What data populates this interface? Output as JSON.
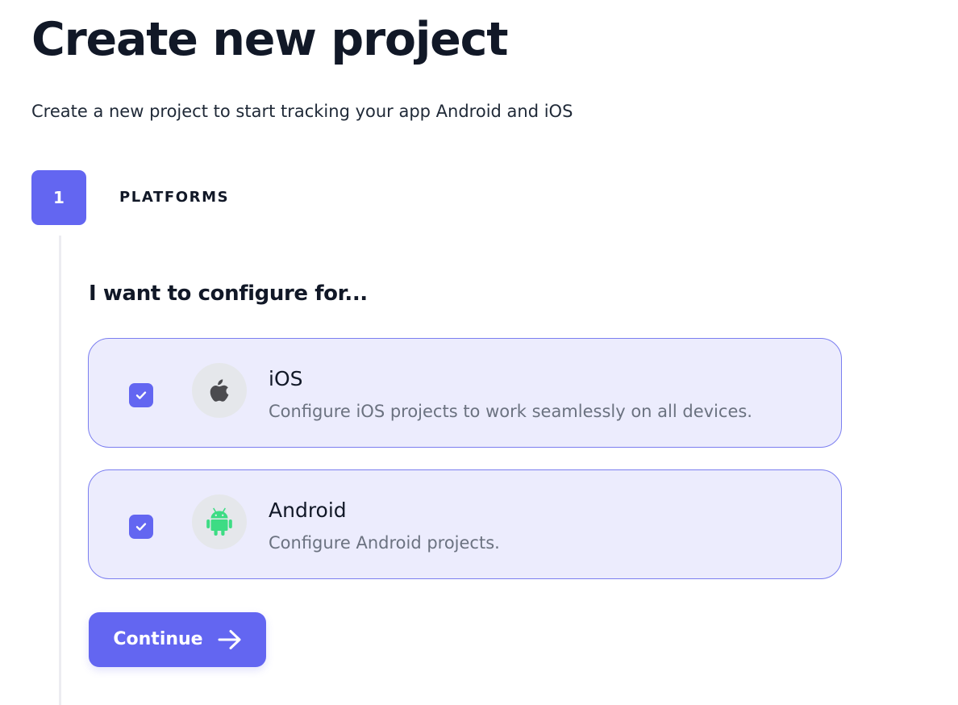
{
  "page": {
    "title": "Create new project",
    "subtitle": "Create a new project to start tracking your app Android and iOS"
  },
  "step": {
    "number": "1",
    "label": "PLATFORMS"
  },
  "section": {
    "heading": "I want to configure for..."
  },
  "options": [
    {
      "title": "iOS",
      "description": "Configure iOS projects to work seamlessly on all devices.",
      "checked": true,
      "icon": "apple-icon"
    },
    {
      "title": "Android",
      "description": "Configure Android projects.",
      "checked": true,
      "icon": "android-icon"
    }
  ],
  "actions": {
    "continue_label": "Continue",
    "continue_icon": "arrow-right-icon"
  },
  "colors": {
    "accent": "#6366f1",
    "card_background": "#ececfd",
    "card_border": "#7b7ef0",
    "android_green": "#3ddc84",
    "apple_gray": "#4b4b4f"
  }
}
